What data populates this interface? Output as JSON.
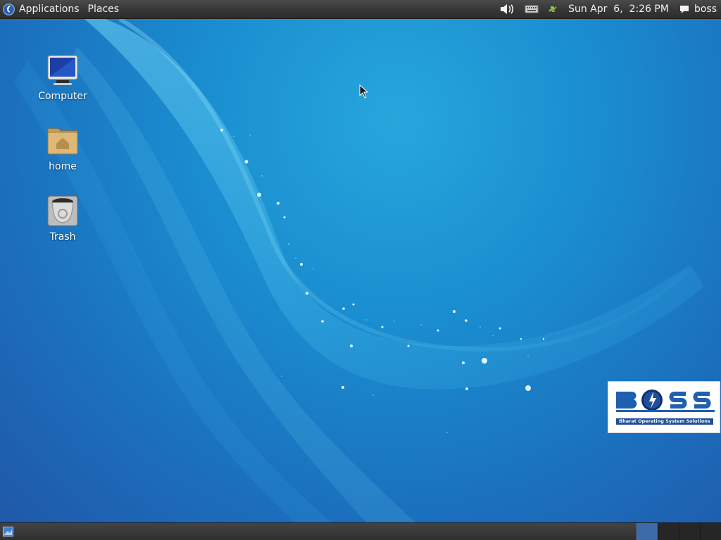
{
  "top_panel": {
    "applications_label": "Applications",
    "places_label": "Places",
    "clock": "Sun Apr  6,  2:26 PM",
    "user": "boss",
    "icons": [
      "debian-swirl-icon",
      "volume-icon",
      "keyboard-icon",
      "network-icon",
      "chat-icon"
    ]
  },
  "desktop": {
    "icons": [
      {
        "label": "Computer",
        "icon": "computer-icon"
      },
      {
        "label": "home",
        "icon": "home-folder-icon"
      },
      {
        "label": "Trash",
        "icon": "trash-icon"
      }
    ],
    "logo": {
      "text": "BOSS",
      "tagline": "Bharat Operating System Solutions"
    }
  },
  "bottom_panel": {
    "workspaces": 4,
    "active_workspace": 1
  },
  "colors": {
    "panel": "#353535",
    "wallpaper_light": "#27a6dc",
    "wallpaper_dark": "#2058a8",
    "logo_blue": "#1f4f9a"
  }
}
